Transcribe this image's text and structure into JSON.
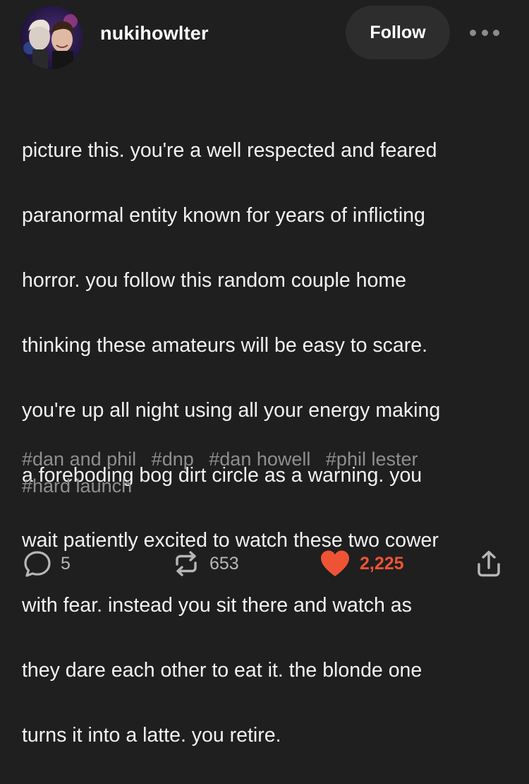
{
  "post": {
    "username": "nukihowlter",
    "follow_label": "Follow",
    "body_lines": [
      "picture this. you're a well respected and feared",
      "paranormal entity known for years of inflicting",
      "horror. you follow this random couple home",
      "thinking these amateurs will be easy to scare.",
      "you're up all night using all your energy making",
      "a foreboding bog dirt circle as a warning. you",
      "wait patiently excited to watch these two cower",
      "with fear. instead you sit there and watch as",
      "they dare each other to eat it. the blonde one",
      "turns it into a latte. you retire."
    ],
    "tags": [
      "#dan and phil",
      "#dnp",
      "#dan howell",
      "#phil lester",
      "#hard launch"
    ]
  },
  "footer": {
    "comments": "5",
    "reblogs": "653",
    "likes": "2,225"
  },
  "icons": {
    "comment": "speech-bubble-icon",
    "reblog": "reblog-icon",
    "like": "heart-icon",
    "share": "share-icon",
    "more": "more-icon"
  },
  "colors": {
    "background": "#1f1f1f",
    "like_accent": "#ef5335",
    "tag_text": "#8f8f8f",
    "muted_icon": "#b7b7b7"
  }
}
